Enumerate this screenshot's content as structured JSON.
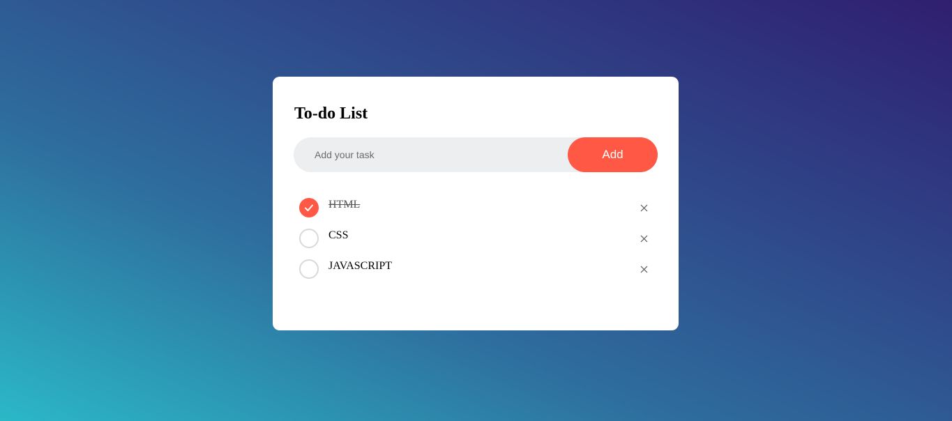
{
  "app": {
    "title": "To-do List"
  },
  "input": {
    "placeholder": "Add your task",
    "value": ""
  },
  "add_button": {
    "label": "Add"
  },
  "tasks": [
    {
      "label": "HTML",
      "checked": true
    },
    {
      "label": "CSS",
      "checked": false
    },
    {
      "label": "JAVASCRIPT",
      "checked": false
    }
  ],
  "icons": {
    "check": "check-icon",
    "remove": "close-icon"
  },
  "colors": {
    "accent": "#ff5945",
    "input_bg": "#edeef0",
    "card_bg": "#ffffff"
  }
}
